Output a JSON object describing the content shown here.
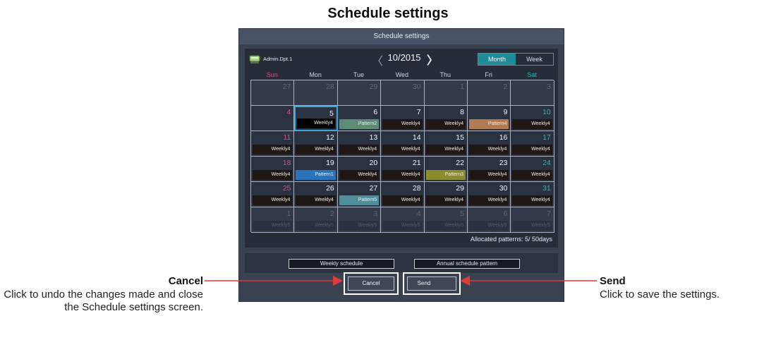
{
  "page_title": "Schedule settings",
  "screen": {
    "title": "Schedule settings",
    "location_label": "Admin.Dpt.1",
    "month_label": "10/2015",
    "view_toggle": {
      "month": "Month",
      "week": "Week",
      "active": "Month"
    },
    "days_of_week": [
      "Sun",
      "Mon",
      "Tue",
      "Wed",
      "Thu",
      "Fri",
      "Sat"
    ],
    "weeks": [
      [
        {
          "day": "27",
          "pattern": ""
        },
        {
          "day": "28",
          "pattern": ""
        },
        {
          "day": "29",
          "pattern": ""
        },
        {
          "day": "30",
          "pattern": ""
        },
        {
          "day": "1",
          "pattern": ""
        },
        {
          "day": "2",
          "pattern": ""
        },
        {
          "day": "3",
          "pattern": ""
        }
      ],
      [
        {
          "day": "4",
          "pattern": ""
        },
        {
          "day": "5",
          "pattern": "Weekly4"
        },
        {
          "day": "6",
          "pattern": "Pattern2"
        },
        {
          "day": "7",
          "pattern": "Weekly4"
        },
        {
          "day": "8",
          "pattern": "Weekly4"
        },
        {
          "day": "9",
          "pattern": "Pattern4"
        },
        {
          "day": "10",
          "pattern": "Weekly4"
        }
      ],
      [
        {
          "day": "11",
          "pattern": "Weekly4"
        },
        {
          "day": "12",
          "pattern": "Weekly4"
        },
        {
          "day": "13",
          "pattern": "Weekly4"
        },
        {
          "day": "14",
          "pattern": "Weekly4"
        },
        {
          "day": "15",
          "pattern": "Weekly4"
        },
        {
          "day": "16",
          "pattern": "Weekly4"
        },
        {
          "day": "17",
          "pattern": "Weekly4"
        }
      ],
      [
        {
          "day": "18",
          "pattern": "Weekly4"
        },
        {
          "day": "19",
          "pattern": "Pattern1"
        },
        {
          "day": "20",
          "pattern": "Weekly4"
        },
        {
          "day": "21",
          "pattern": "Weekly4"
        },
        {
          "day": "22",
          "pattern": "Pattern3"
        },
        {
          "day": "23",
          "pattern": "Weekly4"
        },
        {
          "day": "24",
          "pattern": "Weekly4"
        }
      ],
      [
        {
          "day": "25",
          "pattern": "Weekly4"
        },
        {
          "day": "26",
          "pattern": "Weekly4"
        },
        {
          "day": "27",
          "pattern": "Pattern5"
        },
        {
          "day": "28",
          "pattern": "Weekly4"
        },
        {
          "day": "29",
          "pattern": "Weekly4"
        },
        {
          "day": "30",
          "pattern": "Weekly4"
        },
        {
          "day": "31",
          "pattern": "Weekly4"
        }
      ],
      [
        {
          "day": "1",
          "pattern": "Weekly5"
        },
        {
          "day": "2",
          "pattern": "Weekly5"
        },
        {
          "day": "3",
          "pattern": "Weekly5"
        },
        {
          "day": "4",
          "pattern": "Weekly5"
        },
        {
          "day": "5",
          "pattern": "Weekly5"
        },
        {
          "day": "6",
          "pattern": "Weekly5"
        },
        {
          "day": "7",
          "pattern": "Weekly5"
        }
      ]
    ],
    "selected_day": "5",
    "allocated_patterns": "Allocated patterns: 5/ 50days",
    "weekly_schedule_button": "Weekly schedule",
    "annual_pattern_button": "Annual schedule pattern",
    "cancel_button": "Cancel",
    "send_button": "Send"
  },
  "callouts": {
    "cancel": {
      "title": "Cancel",
      "description": "Click to undo the changes made and close the Schedule settings screen."
    },
    "send": {
      "title": "Send",
      "description": "Click to save the settings."
    }
  },
  "colors": {
    "sunday": "#e0497a",
    "saturday": "#2fb6c4",
    "month_active": "#1b8c97",
    "callout_line": "#e03a3a",
    "pattern_colors": {
      "Weekly4": "#1e1713",
      "Pattern1": "#2a73b8",
      "Pattern2": "#5f8a73",
      "Pattern3": "#8d8c2c",
      "Pattern4": "#b07a52",
      "Pattern5": "#4f8f99",
      "Weekly5": "#2a3140"
    }
  }
}
